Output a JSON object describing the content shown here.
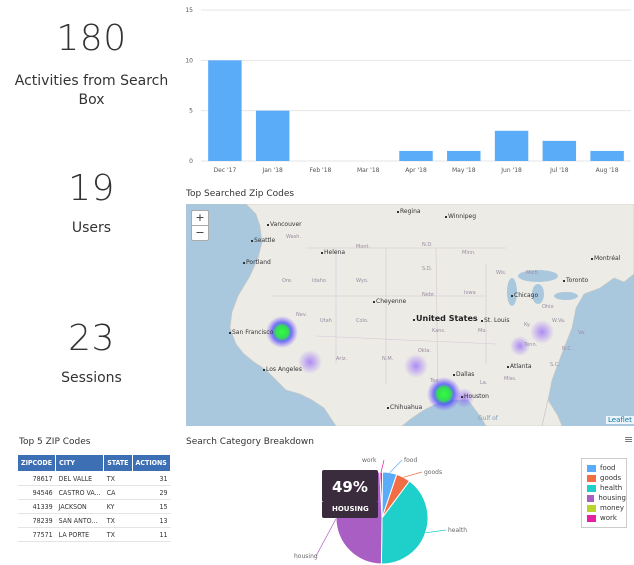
{
  "stats": [
    {
      "value": "180",
      "label": "Activities from Search Box"
    },
    {
      "value": "19",
      "label": "Users"
    },
    {
      "value": "23",
      "label": "Sessions"
    }
  ],
  "bar_chart": {
    "type": "bar",
    "categories": [
      "Dec '17",
      "Jan '18",
      "Feb '18",
      "Mar '18",
      "Apr '18",
      "May '18",
      "Jun '18",
      "Jul '18",
      "Aug '18"
    ],
    "values": [
      10,
      5,
      0,
      0,
      1,
      1,
      3,
      2,
      1
    ],
    "yticks": [
      "0",
      "5",
      "10",
      "15"
    ],
    "ylim": [
      0,
      15
    ],
    "color": "#5aabf8"
  },
  "map": {
    "title": "Top Searched Zip Codes",
    "zoom_in": "+",
    "zoom_out": "−",
    "attribution": "Leaflet",
    "cities": [
      {
        "name": "Regina"
      },
      {
        "name": "Winnipeg"
      },
      {
        "name": "Vancouver"
      },
      {
        "name": "Seattle"
      },
      {
        "name": "Helena"
      },
      {
        "name": "Portland"
      },
      {
        "name": "Montréal"
      },
      {
        "name": "Toronto"
      },
      {
        "name": "Chicago"
      },
      {
        "name": "Cheyenne"
      },
      {
        "name": "United States"
      },
      {
        "name": "St. Louis"
      },
      {
        "name": "San Francisco"
      },
      {
        "name": "Los Angeles"
      },
      {
        "name": "Atlanta"
      },
      {
        "name": "Dallas"
      },
      {
        "name": "Houston"
      },
      {
        "name": "Chihuahua"
      },
      {
        "name": "Wash."
      },
      {
        "name": "Mont."
      },
      {
        "name": "N.D."
      },
      {
        "name": "Minn."
      },
      {
        "name": "Ore."
      },
      {
        "name": "Idaho"
      },
      {
        "name": "Wyo."
      },
      {
        "name": "S.D."
      },
      {
        "name": "Nebr."
      },
      {
        "name": "Iowa"
      },
      {
        "name": "Nev."
      },
      {
        "name": "Utah"
      },
      {
        "name": "Colo."
      },
      {
        "name": "Kans."
      },
      {
        "name": "Mo."
      },
      {
        "name": "Ariz."
      },
      {
        "name": "N.M."
      },
      {
        "name": "Okla."
      },
      {
        "name": "Tex."
      },
      {
        "name": "La."
      },
      {
        "name": "Miss."
      },
      {
        "name": "Ky."
      },
      {
        "name": "Tenn."
      },
      {
        "name": "Wis."
      },
      {
        "name": "Mich."
      },
      {
        "name": "Ohio"
      },
      {
        "name": "W.Va."
      },
      {
        "name": "Va."
      },
      {
        "name": "N.C."
      },
      {
        "name": "S.C."
      },
      {
        "name": "Gulf of"
      }
    ]
  },
  "zip_table": {
    "title": "Top 5 ZIP Codes",
    "headers": [
      "ZIPCODE",
      "CITY",
      "STATE",
      "ACTIONS"
    ],
    "rows": [
      [
        "78617",
        "DEL VALLE",
        "TX",
        "31"
      ],
      [
        "94546",
        "CASTRO VA...",
        "CA",
        "29"
      ],
      [
        "41339",
        "JACKSON",
        "KY",
        "15"
      ],
      [
        "78239",
        "SAN ANTO...",
        "TX",
        "13"
      ],
      [
        "77571",
        "LA PORTE",
        "TX",
        "11"
      ]
    ]
  },
  "pie": {
    "title": "Search Category Breakdown",
    "menu_icon": "≡",
    "tooltip_value": "49%",
    "tooltip_label": "HOUSING",
    "legend": [
      {
        "name": "food",
        "color": "#5aabf8"
      },
      {
        "name": "goods",
        "color": "#f26d44"
      },
      {
        "name": "health",
        "color": "#1fcfc9"
      },
      {
        "name": "housing",
        "color": "#a85ec2"
      },
      {
        "name": "money",
        "color": "#b7d52b"
      },
      {
        "name": "work",
        "color": "#e81ea5"
      }
    ],
    "slice_labels": [
      "work",
      "food",
      "goods",
      "health",
      "housing"
    ]
  },
  "chart_data": [
    {
      "type": "bar",
      "categories": [
        "Dec '17",
        "Jan '18",
        "Feb '18",
        "Mar '18",
        "Apr '18",
        "May '18",
        "Jun '18",
        "Jul '18",
        "Aug '18"
      ],
      "values": [
        10,
        5,
        0,
        0,
        1,
        1,
        3,
        2,
        1
      ],
      "title": "",
      "xlabel": "",
      "ylabel": "",
      "ylim": [
        0,
        15
      ],
      "grid": true
    },
    {
      "type": "pie",
      "title": "Search Category Breakdown",
      "categories": [
        "food",
        "goods",
        "health",
        "housing",
        "money",
        "work"
      ],
      "values": [
        5,
        5,
        40,
        49,
        0,
        1
      ],
      "legend": "right"
    }
  ]
}
